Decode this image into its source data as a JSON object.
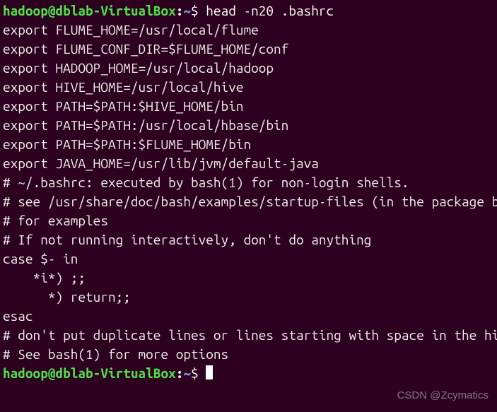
{
  "prompt": {
    "user": "hadoop",
    "at": "@",
    "host": "dblab-VirtualBox",
    "colon": ":",
    "path": "~",
    "symbol": "$ "
  },
  "command": "head -n20 .bashrc",
  "output": [
    "export FLUME_HOME=/usr/local/flume",
    "export FLUME_CONF_DIR=$FLUME_HOME/conf",
    "export HADOOP_HOME=/usr/local/hadoop",
    "export HIVE_HOME=/usr/local/hive",
    "export PATH=$PATH:$HIVE_HOME/bin",
    "export PATH=$PATH:/usr/local/hbase/bin",
    "export PATH=$PATH:$FLUME_HOME/bin",
    "export JAVA_HOME=/usr/lib/jvm/default-java",
    "# ~/.bashrc: executed by bash(1) for non-login shells.",
    "# see /usr/share/doc/bash/examples/startup-files (in the package bash-doc)",
    "# for examples",
    "",
    "# If not running interactively, don't do anything",
    "case $- in",
    "    *i*) ;;",
    "      *) return;;",
    "esac",
    "",
    "# don't put duplicate lines or lines starting with space in the history.",
    "# See bash(1) for more options"
  ],
  "watermark": "CSDN @Zcymatics"
}
